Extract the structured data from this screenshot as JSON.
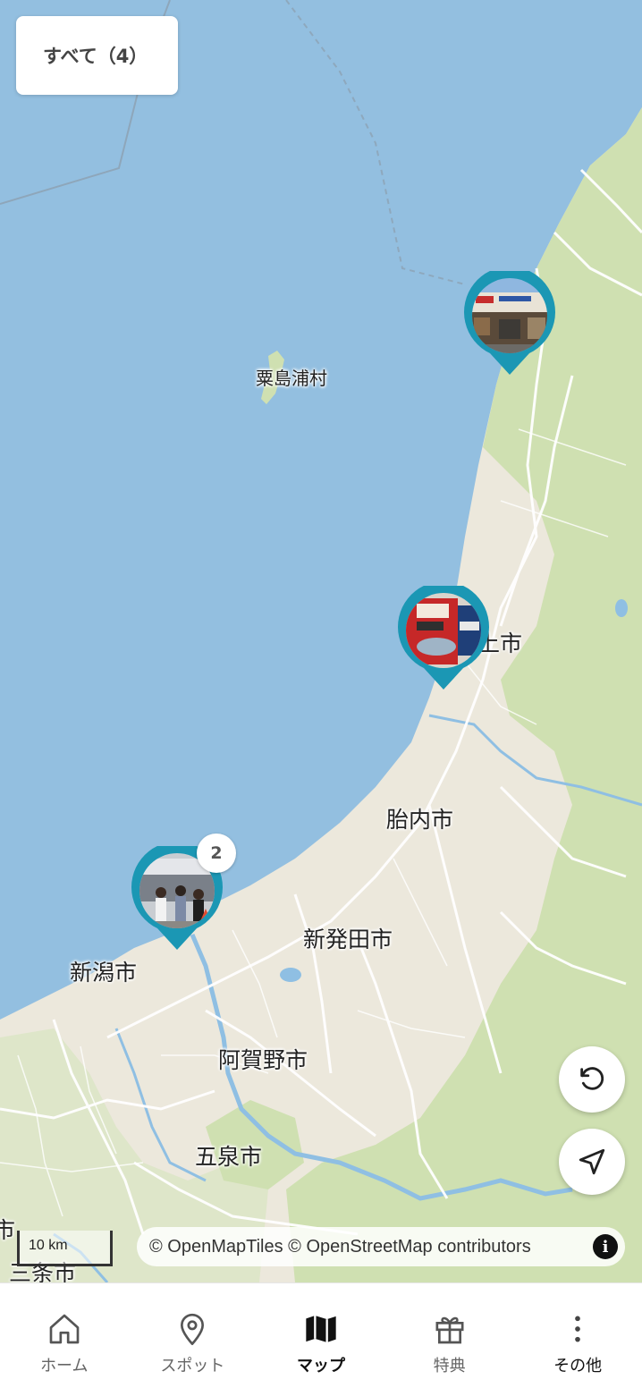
{
  "filter": {
    "label": "すべて（4）"
  },
  "map": {
    "colors": {
      "sea": "#93bfe0",
      "land_urban": "#ece8dc",
      "land_forest": "#cfe0b1",
      "pin": "#1b97b4"
    },
    "labels": {
      "island": "粟島浦村",
      "murakami": "上市",
      "tainai": "胎内市",
      "shibata": "新発田市",
      "niigata": "新潟市",
      "agano": "阿賀野市",
      "gosen": "五泉市",
      "sanjo": "三条市",
      "edge": "市"
    },
    "pins": [
      {
        "name": "pin-north",
        "photo": "market-storefront",
        "count": null
      },
      {
        "name": "pin-middle",
        "photo": "red-shop-banner",
        "count": null
      },
      {
        "name": "pin-south",
        "photo": "crowd-at-market",
        "count": "2"
      }
    ],
    "scale_label": "10 km",
    "attribution": "© OpenMapTiles © OpenStreetMap contributors",
    "info_icon": "i"
  },
  "controls": {
    "reset_icon": "rotate-ccw-icon",
    "locate_icon": "navigation-arrow-icon"
  },
  "tabs": [
    {
      "label": "ホーム",
      "icon": "home-icon",
      "active": false
    },
    {
      "label": "スポット",
      "icon": "map-pin-icon",
      "active": false
    },
    {
      "label": "マップ",
      "icon": "map-icon",
      "active": true
    },
    {
      "label": "特典",
      "icon": "gift-icon",
      "active": false
    },
    {
      "label": "その他",
      "icon": "more-vertical-icon",
      "active": false
    }
  ]
}
